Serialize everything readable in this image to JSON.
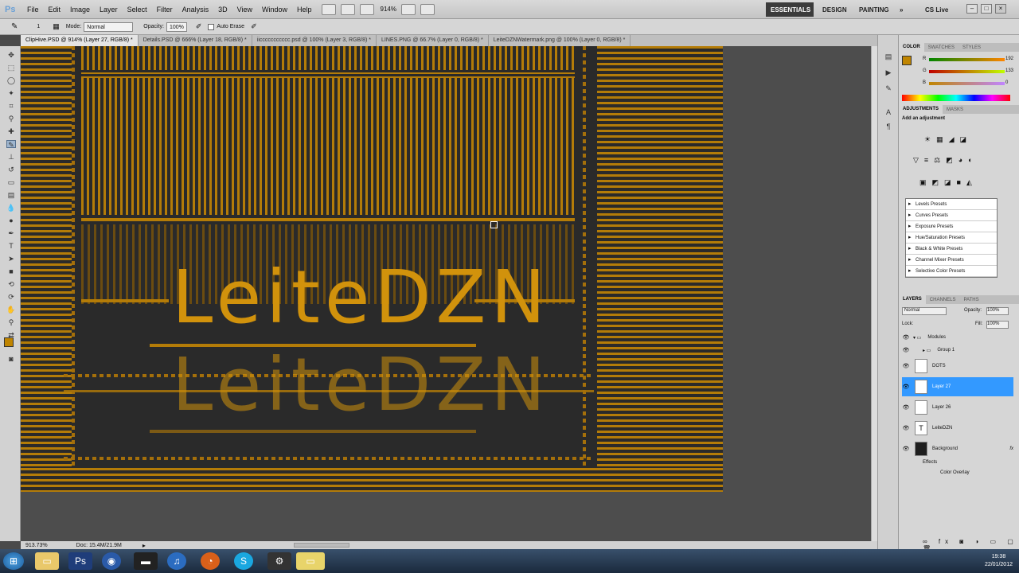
{
  "app": {
    "logo": "Ps"
  },
  "menu": [
    "File",
    "Edit",
    "Image",
    "Layer",
    "Select",
    "Filter",
    "Analysis",
    "3D",
    "View",
    "Window",
    "Help"
  ],
  "zoom_value": "914%",
  "workspaces": {
    "essentials": "ESSENTIALS",
    "design": "DESIGN",
    "painting": "PAINTING",
    "more": "»",
    "cs_live": "CS Live"
  },
  "options": {
    "mode_label": "Mode:",
    "mode_value": "Normal",
    "opacity_label": "Opacity:",
    "opacity_value": "100%",
    "auto_erase": "Auto Erase",
    "brush_size": "1"
  },
  "tabs": [
    "ClipHive.PSD @ 914% (Layer 27, RGB/8) *",
    "Details.PSD @ 666% (Layer 18, RGB/8) *",
    "iiccccccccccc.psd @ 100% (Layer 3, RGB/8) *",
    "LINES.PNG @ 66.7% (Layer 0, RGB/8) *",
    "LeiteDZNWatermark.png @ 100% (Layer 0, RGB/8) *"
  ],
  "canvas": {
    "logo_text": "LeiteDZN",
    "accent": "#b47c08"
  },
  "status": {
    "zoom": "913.73%",
    "doc": "Doc: 15.4M/21.9M"
  },
  "color_panel": {
    "tabs": [
      "COLOR",
      "SWATCHES",
      "STYLES"
    ],
    "r_label": "R",
    "r": "192",
    "g_label": "G",
    "g": "133",
    "b_label": "B",
    "b": "0",
    "fg_color": "#c08500"
  },
  "adjustments": {
    "tabs": [
      "ADJUSTMENTS",
      "MASKS"
    ],
    "title": "Add an adjustment",
    "presets": [
      "Levels Presets",
      "Curves Presets",
      "Exposure Presets",
      "Hue/Saturation Presets",
      "Black & White Presets",
      "Channel Mixer Presets",
      "Selective Color Presets"
    ]
  },
  "layers_panel": {
    "tabs": [
      "LAYERS",
      "CHANNELS",
      "PATHS"
    ],
    "blend": "Normal",
    "opacity_label": "Opacity:",
    "opacity": "100%",
    "lock_label": "Lock:",
    "fill_label": "Fill:",
    "fill": "100%",
    "layers": [
      {
        "name": "Modules"
      },
      {
        "name": "Group 1"
      },
      {
        "name": "DOTS"
      },
      {
        "name": "Layer 27"
      },
      {
        "name": "Layer 26"
      },
      {
        "name": "LeiteDZN"
      },
      {
        "name": "Background"
      }
    ],
    "effects_label": "Effects",
    "effect": "Color Overlay",
    "fx": "fx"
  },
  "taskbar": {
    "time": "19:38",
    "date": "22/01/2012"
  }
}
